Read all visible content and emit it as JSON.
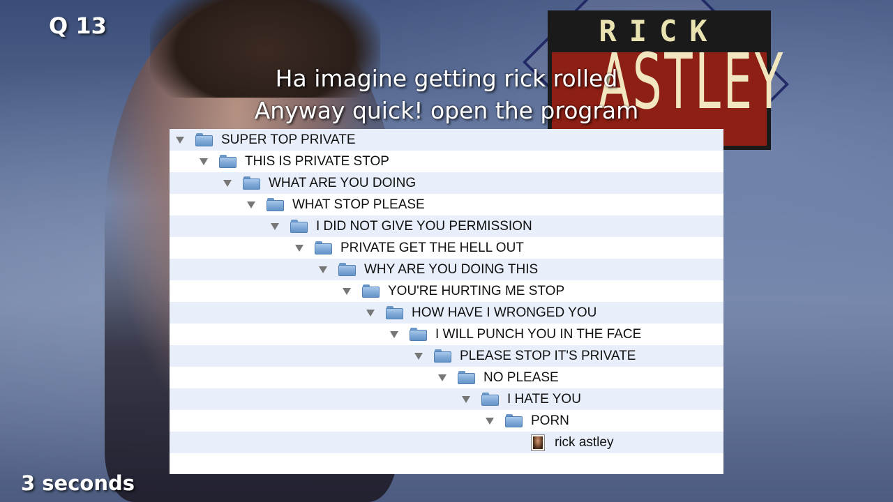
{
  "slide": {
    "question_label": "Q 13",
    "timer_label": "3 seconds",
    "caption_line1": "Ha imagine getting rick rolled",
    "caption_line2": "Anyway quick! open the program"
  },
  "background_logo": {
    "top_text": "RICK",
    "main_text": "ASTLEY"
  },
  "tree": {
    "folders": [
      {
        "label": "SUPER TOP PRIVATE"
      },
      {
        "label": "THIS IS PRIVATE STOP"
      },
      {
        "label": "WHAT ARE YOU DOING"
      },
      {
        "label": "WHAT STOP PLEASE"
      },
      {
        "label": "I DID NOT GIVE YOU PERMISSION"
      },
      {
        "label": "PRIVATE GET THE HELL OUT"
      },
      {
        "label": "WHY ARE YOU DOING THIS"
      },
      {
        "label": "YOU'RE HURTING ME STOP"
      },
      {
        "label": "HOW HAVE I WRONGED YOU"
      },
      {
        "label": "I WILL PUNCH YOU IN THE FACE"
      },
      {
        "label": "PLEASE STOP IT'S PRIVATE"
      },
      {
        "label": "NO PLEASE"
      },
      {
        "label": "I HATE YOU"
      },
      {
        "label": "PORN"
      }
    ],
    "file": {
      "label": "rick astley",
      "icon": "photo-file-icon"
    }
  }
}
